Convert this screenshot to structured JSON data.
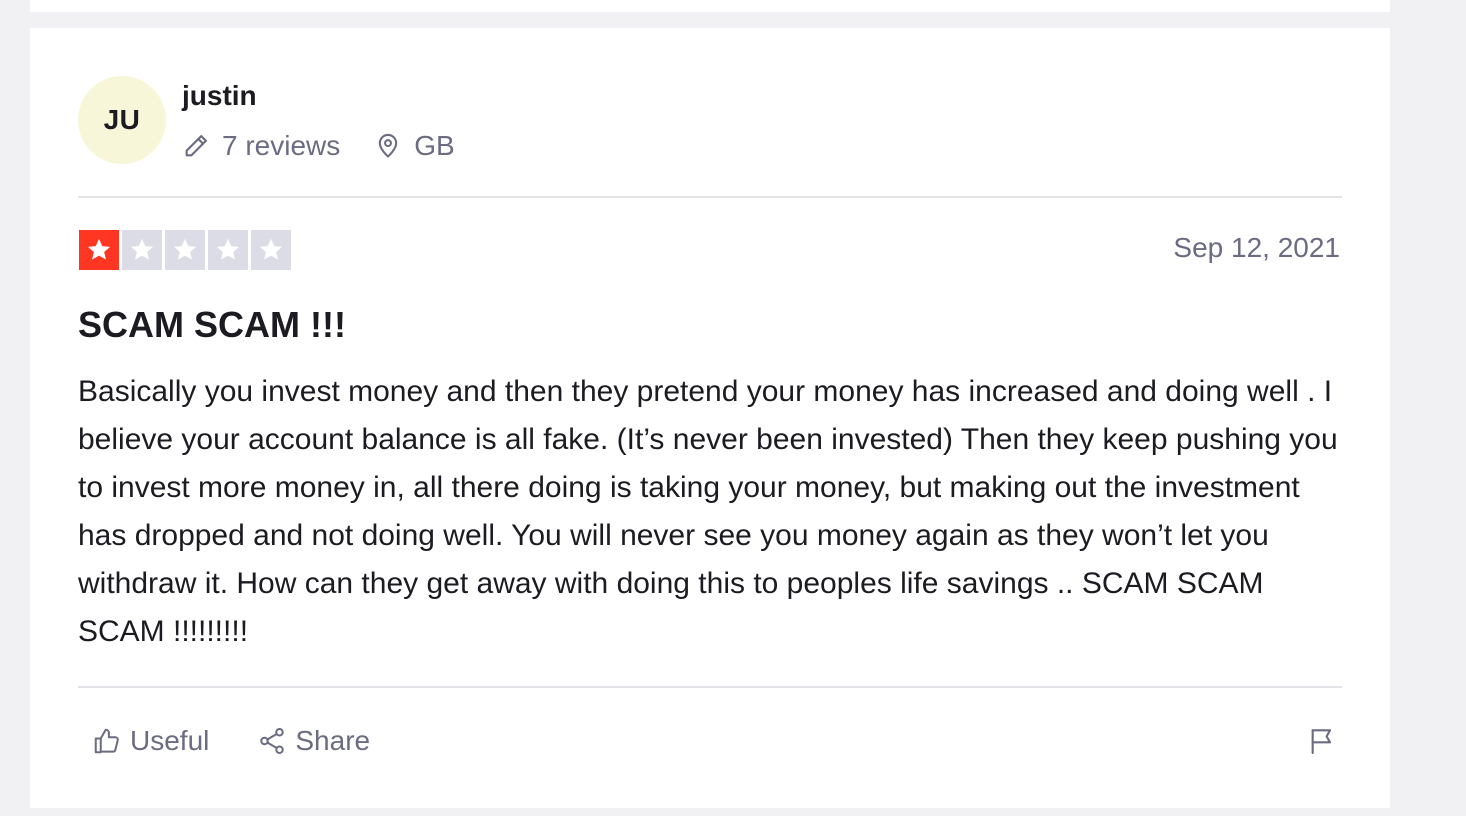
{
  "reviewer": {
    "initials": "JU",
    "name": "justin",
    "reviews_count": "7 reviews",
    "country": "GB"
  },
  "review": {
    "rating": 1,
    "max_rating": 5,
    "date": "Sep 12, 2021",
    "title": "SCAM SCAM !!!",
    "body": "Basically you invest money and then they pretend your money has increased and doing well . I believe your account balance is all fake. (It’s never been invested) Then they keep pushing you to invest more money in, all there doing is taking your money, but making out the investment has dropped and not doing well. You will never see you money again as they won’t let you withdraw it. How can they get away with doing this to peoples life savings .. SCAM SCAM SCAM !!!!!!!!!"
  },
  "actions": {
    "useful_label": "Useful",
    "share_label": "Share"
  },
  "colors": {
    "star_filled": "#ff3722",
    "star_empty": "#dcdce6",
    "avatar_bg": "#f8f6d9",
    "muted_text": "#6b6b82"
  },
  "icons": {
    "reviews": "pencil-icon",
    "location": "location-pin-icon",
    "useful": "thumbs-up-icon",
    "share": "share-icon",
    "report": "flag-icon"
  }
}
